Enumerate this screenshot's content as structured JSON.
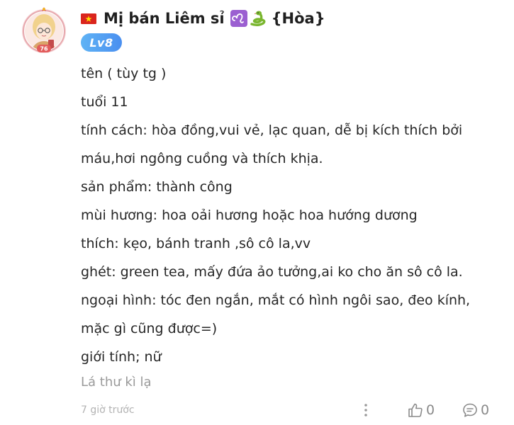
{
  "comment": {
    "author": {
      "flag_icon": "vietnam-flag-icon",
      "name": "Mị bán Liêm sỉ",
      "zodiac_icon": "leo-icon",
      "emoji_icon": "snake-icon",
      "name_suffix": "{Hòa}",
      "level": "Lv8",
      "avatar_badge": "76"
    },
    "lines": [
      "tên ( tùy tg )",
      "tuổi 11",
      "tính cách: hòa đồng,vui vẻ, lạc quan, dễ bị kích thích bởi",
      "máu,hơi ngông cuồng và thích khịa.",
      "sản phẩm: thành công",
      "mùi hương: hoa oải hương hoặc hoa hướng dương",
      "thích: kẹo, bánh tranh ,sô cô la,vv",
      "ghét: green tea, mấy đứa ảo tưởng,ai ko cho ăn sô cô la.",
      "ngoại hình: tóc đen ngắn, mắt có hình ngôi sao, đeo kính,",
      "mặc gì cũng được=)",
      "giới tính; nữ"
    ],
    "source": "Lá thư kì lạ",
    "timestamp": "7 giờ trước",
    "like_count": "0",
    "reply_count": "0"
  },
  "colors": {
    "badge": "#4a8ff0",
    "text": "#262626",
    "muted": "#9a9a9a"
  }
}
